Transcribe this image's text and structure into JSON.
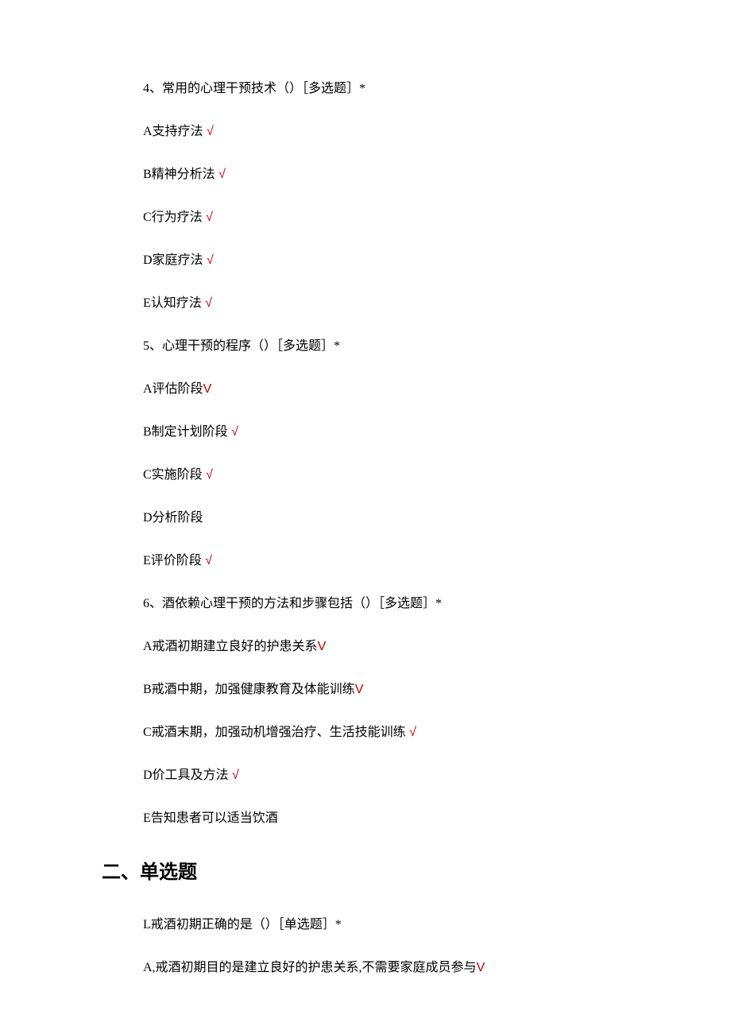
{
  "questions": {
    "q4": {
      "text": "4、常用的心理干预技术（）［多选题］*",
      "options": [
        {
          "text": "A支持疗法",
          "mark": " √",
          "markType": "check"
        },
        {
          "text": "B精神分析法",
          "mark": " √",
          "markType": "check"
        },
        {
          "text": "C行为疗法",
          "mark": " √",
          "markType": "check"
        },
        {
          "text": "D家庭疗法",
          "mark": " √",
          "markType": "check"
        },
        {
          "text": "E认知疗法",
          "mark": " √",
          "markType": "check"
        }
      ]
    },
    "q5": {
      "text": "5、心理干预的程序（）［多选题］*",
      "options": [
        {
          "text": "A评估阶段",
          "mark": "V",
          "markType": "v"
        },
        {
          "text": "B制定计划阶段",
          "mark": " √",
          "markType": "check"
        },
        {
          "text": "C实施阶段",
          "mark": " √",
          "markType": "check"
        },
        {
          "text": "D分析阶段",
          "mark": "",
          "markType": "none"
        },
        {
          "text": "E评价阶段",
          "mark": " √",
          "markType": "check"
        }
      ]
    },
    "q6": {
      "text": "6、酒依赖心理干预的方法和步骤包括（）［多选题］*",
      "options": [
        {
          "text": "A戒酒初期建立良好的护患关系",
          "mark": "V",
          "markType": "v"
        },
        {
          "text": "B戒酒中期，加强健康教育及体能训练",
          "mark": "V",
          "markType": "v"
        },
        {
          "text": "C戒酒末期，加强动机增强治疗、生活技能训练",
          "mark": " √",
          "markType": "check"
        },
        {
          "text": "D价工具及方法",
          "mark": " √",
          "markType": "check"
        },
        {
          "text": "E告知患者可以适当饮酒",
          "mark": "",
          "markType": "none"
        }
      ]
    }
  },
  "sectionHeader": "二、单选题",
  "section2": {
    "q1": {
      "text": "L戒酒初期正确的是（）［单选题］*",
      "options": [
        {
          "text": "A,戒酒初期目的是建立良好的护患关系,不需要家庭成员参与",
          "mark": "V",
          "markType": "v"
        }
      ]
    }
  }
}
